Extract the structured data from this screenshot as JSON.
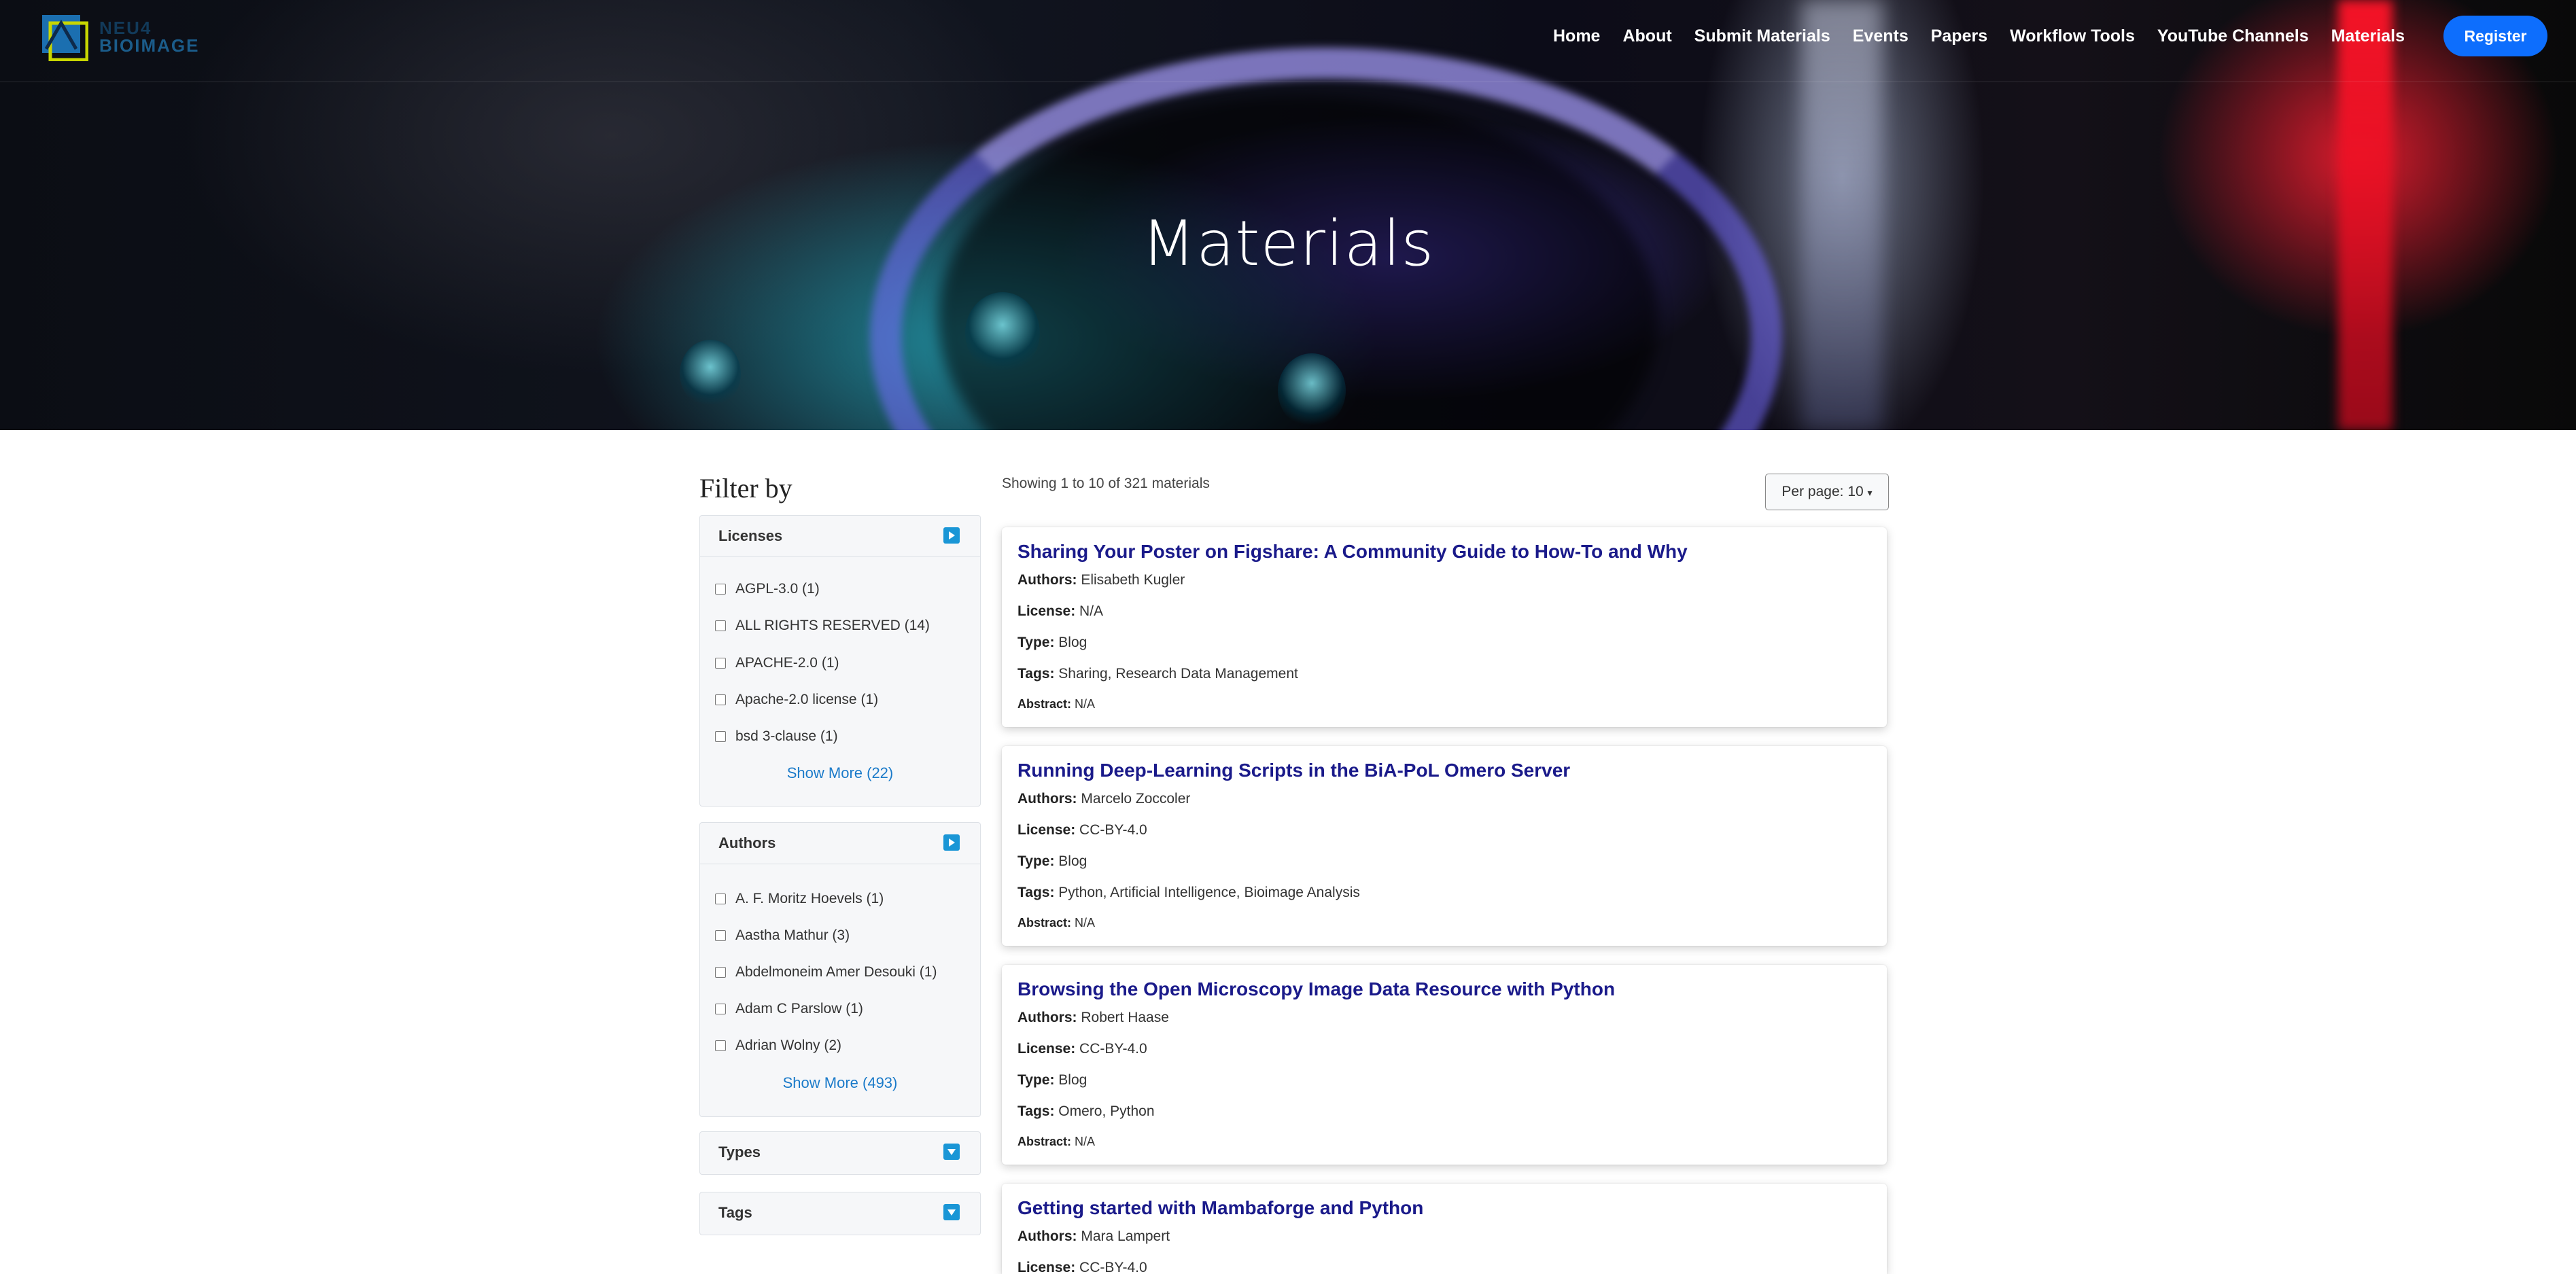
{
  "brand": {
    "line1": "NEU4",
    "line2": "BIOIMAGE"
  },
  "nav": {
    "items": [
      "Home",
      "About",
      "Submit Materials",
      "Events",
      "Papers",
      "Workflow Tools",
      "YouTube Channels",
      "Materials"
    ],
    "register": "Register"
  },
  "hero": {
    "title": "Materials"
  },
  "sidebar": {
    "title": "Filter by",
    "licenses": {
      "title": "Licenses",
      "options": [
        "AGPL-3.0 (1)",
        "ALL RIGHTS RESERVED (14)",
        "APACHE-2.0 (1)",
        "Apache-2.0 license (1)",
        "bsd 3-clause (1)"
      ],
      "show_more": "Show More (22)"
    },
    "authors": {
      "title": "Authors",
      "options": [
        "A. F. Moritz Hoevels (1)",
        "Aastha Mathur (3)",
        "Abdelmoneim Amer Desouki (1)",
        "Adam C Parslow (1)",
        "Adrian Wolny (2)"
      ],
      "show_more": "Show More (493)"
    },
    "types": {
      "title": "Types"
    },
    "tags": {
      "title": "Tags"
    }
  },
  "results": {
    "summary": "Showing 1 to 10 of 321 materials",
    "per_page": "Per page: 10",
    "labels": {
      "authors": "Authors:",
      "license": "License:",
      "type": "Type:",
      "tags": "Tags:",
      "abstract": "Abstract:"
    },
    "cards": [
      {
        "title": "Sharing Your Poster on Figshare: A Community Guide to How-To and Why",
        "authors": "Elisabeth Kugler",
        "license": "N/A",
        "type": "Blog",
        "tags": "Sharing, Research Data Management",
        "abstract": "N/A"
      },
      {
        "title": "Running Deep-Learning Scripts in the BiA-PoL Omero Server",
        "authors": "Marcelo Zoccoler",
        "license": "CC-BY-4.0",
        "type": "Blog",
        "tags": "Python, Artificial Intelligence, Bioimage Analysis",
        "abstract": "N/A"
      },
      {
        "title": "Browsing the Open Microscopy Image Data Resource with Python",
        "authors": "Robert Haase",
        "license": "CC-BY-4.0",
        "type": "Blog",
        "tags": "Omero, Python",
        "abstract": "N/A"
      },
      {
        "title": "Getting started with Mambaforge and Python",
        "authors": "Mara Lampert",
        "license": "CC-BY-4.0",
        "type": "",
        "tags": "",
        "abstract": ""
      }
    ]
  },
  "colors": {
    "accent": "#0d6efd",
    "title_link": "#1a1a8a",
    "toggle": "#1a96d6"
  }
}
